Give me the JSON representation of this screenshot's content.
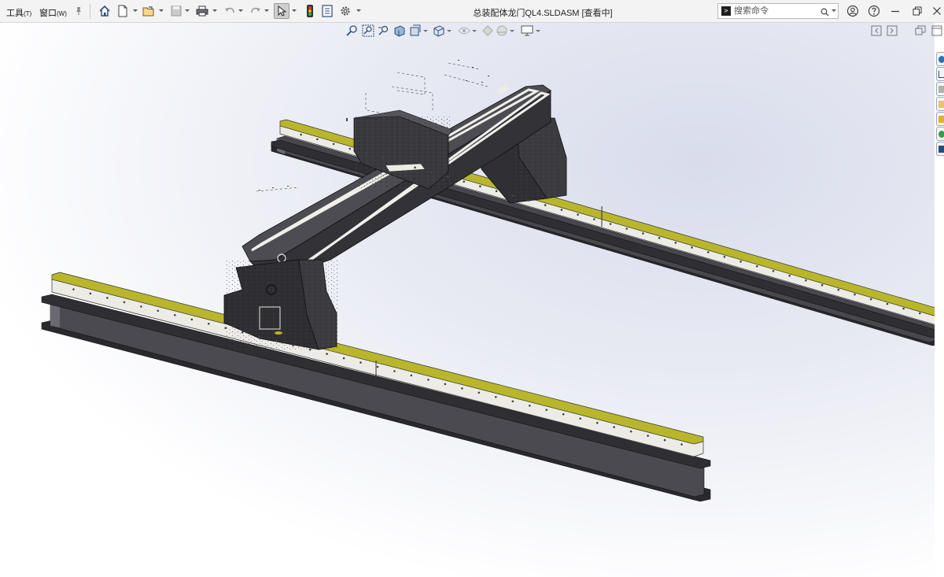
{
  "menu": {
    "tools": "工具",
    "tools_hotkey": "(T)",
    "window": "窗口",
    "window_hotkey": "(W)"
  },
  "document": {
    "title": "总装配体龙门QL4.SLDASM [查看中]"
  },
  "search": {
    "placeholder": "搜索命令"
  },
  "icons": {
    "pin": "pin-icon",
    "home": "home-icon",
    "new": "new-document-icon",
    "open": "open-folder-icon",
    "save": "save-icon",
    "print": "print-icon",
    "undo": "undo-icon",
    "redo": "redo-icon",
    "select": "select-pointer-icon",
    "rebuild": "traffic-light-icon",
    "file_properties": "file-properties-icon",
    "options": "gear-icon",
    "account": "user-account-icon",
    "help": "help-icon"
  },
  "colors": {
    "rail_stripe": "#b9b62c",
    "steel_dark": "#3c3b40",
    "steel_light": "#ecebe6",
    "background_tint": "#d9dcec"
  }
}
